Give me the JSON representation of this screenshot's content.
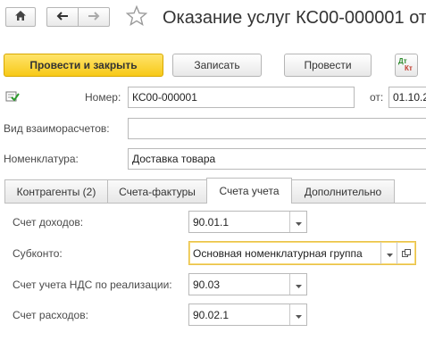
{
  "header": {
    "title": "Оказание услуг КС00-000001 от"
  },
  "toolbar": {
    "post_close_label": "Провести и закрыть",
    "save_label": "Записать",
    "post_label": "Провести",
    "dtkt_top": "Дт",
    "dtkt_bottom": "Кт"
  },
  "form": {
    "number_label": "Номер:",
    "number_value": "КС00-000001",
    "date_label": "от:",
    "date_value": "01.10.2",
    "settlement_label": "Вид взаиморасчетов:",
    "settlement_value": "",
    "nomenclature_label": "Номенклатура:",
    "nomenclature_value": "Доставка товара"
  },
  "tabs": [
    {
      "label": "Контрагенты (2)"
    },
    {
      "label": "Счета-фактуры"
    },
    {
      "label": "Счета учета"
    },
    {
      "label": "Дополнительно"
    }
  ],
  "accounts": {
    "income_label": "Счет доходов:",
    "income_value": "90.01.1",
    "subconto_label": "Субконто:",
    "subconto_value": "Основная номенклатурная группа",
    "vat_label": "Счет учета НДС по реализации:",
    "vat_value": "90.03",
    "expense_label": "Счет расходов:",
    "expense_value": "90.02.1"
  },
  "colors": {
    "primary_button": "#f7c918",
    "focus_border": "#e9c24a",
    "dtkt_green": "#2e8b2e",
    "dtkt_red": "#c0392b"
  }
}
